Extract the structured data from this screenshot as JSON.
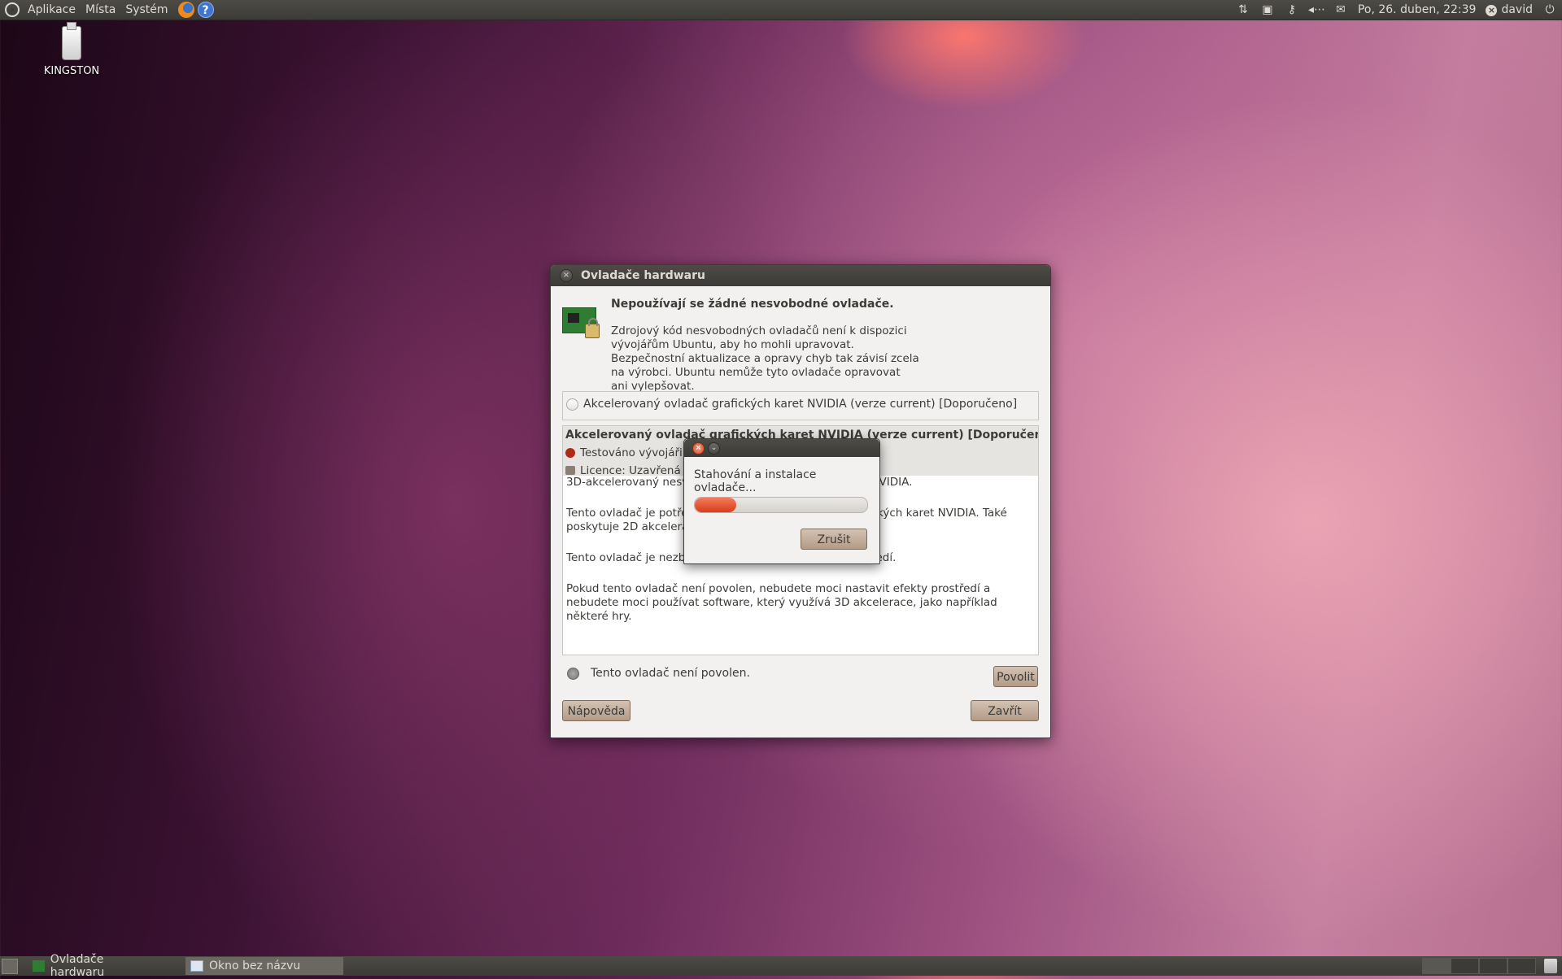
{
  "top_panel": {
    "menus": [
      "Aplikace",
      "Místa",
      "Systém"
    ],
    "datetime": "Po, 26. duben, 22:39",
    "user": "david",
    "tray_icons": [
      "network-transfer-icon",
      "hardware-drivers-icon",
      "keyring-icon",
      "volume-icon",
      "mail-icon"
    ]
  },
  "desktop": {
    "icon_label": "KINGSTON"
  },
  "main_window": {
    "title": "Ovladače hardwaru",
    "heading": "Nepoužívají se žádné nesvobodné ovladače.",
    "description": "Zdrojový kód nesvobodných ovladačů není k dispozici vývojářům Ubuntu, aby ho mohli upravovat. Bezpečnostní aktualizace a opravy chyb tak závisí zcela na výrobci. Ubuntu nemůže tyto ovladače opravovat ani vylepšovat.",
    "driver_name": "Akcelerovaný ovladač grafických karet NVIDIA (verze current) [Doporučeno]",
    "detail_title": "Akcelerovaný ovladač grafických karet NVIDIA (verze current) [Doporučeno]",
    "tested_label": "Testováno vývojáři",
    "license_label": "Licence: Uzavřená",
    "detail_paragraphs": [
      "3D-akcelerovaný nesvobodný ovladač grafických karet NVIDIA.",
      "Tento ovladač je potřebný pro plnou 3D akceleraci grafických karet NVIDIA. Také poskytuje 2D akceleraci nebo je potřebný pro nové karty.",
      "Tento ovladač je nezbytný pro plně funkční efekty prostředí.",
      "Pokud tento ovladač není povolen, nebudete moci nastavit efekty prostředí a nebudete moci používat software, který využívá 3D akcelerace, jako například některé hry."
    ],
    "status_text": "Tento ovladač není povolen.",
    "enable_button": "Povolit",
    "help_button": "Nápověda",
    "close_button": "Zavřít"
  },
  "progress_dialog": {
    "message": "Stahování a instalace ovladače...",
    "progress_fraction": 0.24,
    "cancel_button": "Zrušit"
  },
  "bottom_panel": {
    "tasks": [
      "Ovladače hardwaru",
      "Okno bez názvu"
    ]
  },
  "colors": {
    "panel": "#3c3b37",
    "progress": "#e4512e",
    "button": "#c4b09e"
  }
}
